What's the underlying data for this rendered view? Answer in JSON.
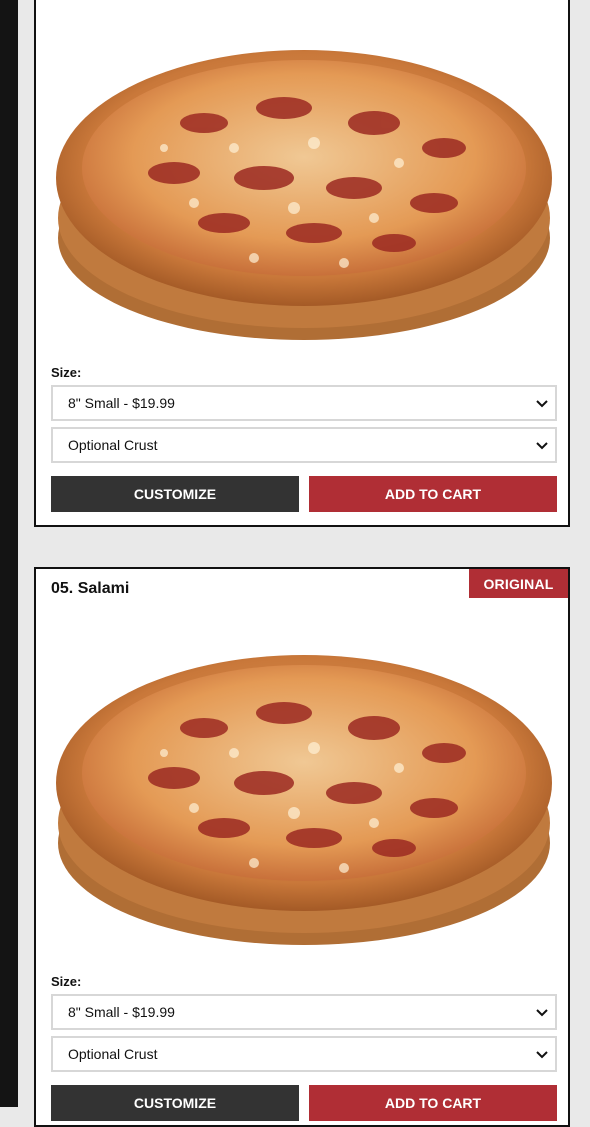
{
  "products": [
    {
      "title": "",
      "badge": "",
      "size_label": "Size:",
      "size_selected": "8\" Small - $19.99",
      "crust_selected": "Optional Crust",
      "customize_label": "CUSTOMIZE",
      "add_label": "ADD TO CART"
    },
    {
      "title": "05. Salami",
      "badge": "ORIGINAL",
      "size_label": "Size:",
      "size_selected": "8\" Small - $19.99",
      "crust_selected": "Optional Crust",
      "customize_label": "CUSTOMIZE",
      "add_label": "ADD TO CART"
    }
  ],
  "colors": {
    "accent_red": "#b02e35",
    "dark_button": "#333333",
    "page_bg": "#e9e9e9",
    "side_strip": "#141414"
  },
  "icons": {
    "select_arrow": "chevron-down-icon",
    "pizza_image": "salami-pizza-image"
  }
}
